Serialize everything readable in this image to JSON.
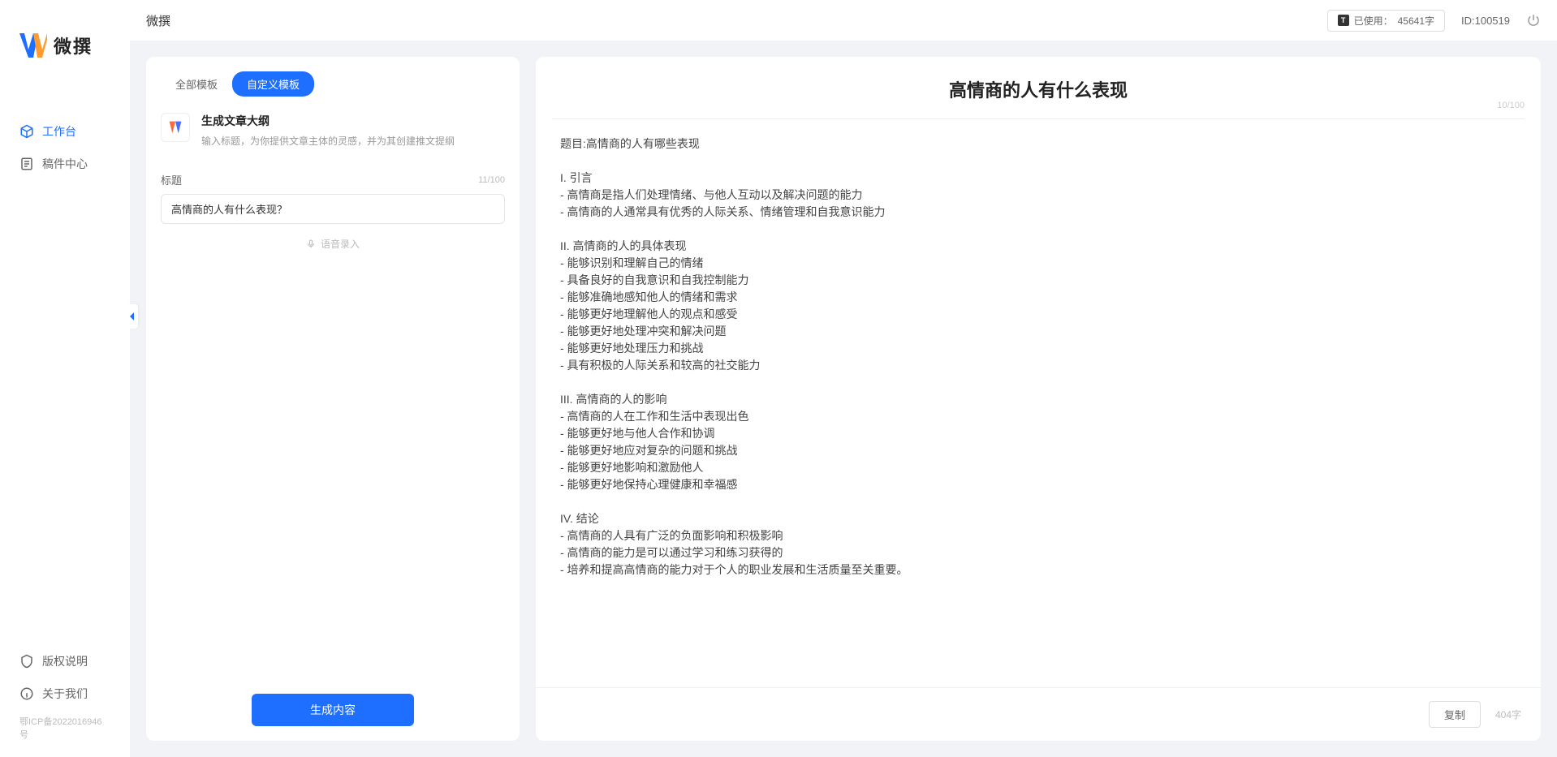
{
  "brand": "微撰",
  "sidebar": {
    "nav": [
      {
        "label": "工作台",
        "icon": "cube"
      },
      {
        "label": "稿件中心",
        "icon": "doc"
      }
    ],
    "bottom": [
      {
        "label": "版权说明",
        "icon": "shield"
      },
      {
        "label": "关于我们",
        "icon": "info"
      }
    ],
    "icp": "鄂ICP备2022016946号"
  },
  "topbar": {
    "title": "微撰",
    "usage_label": "已使用：",
    "usage_value": "45641字",
    "id_label": "ID:100519"
  },
  "tabs": {
    "all": "全部模板",
    "custom": "自定义模板"
  },
  "template": {
    "title": "生成文章大纲",
    "desc": "输入标题，为你提供文章主体的灵感，并为其创建推文提纲"
  },
  "form": {
    "title_label": "标题",
    "title_count": "11/100",
    "title_value": "高情商的人有什么表现？",
    "voice_hint": "语音录入"
  },
  "generate_label": "生成内容",
  "output": {
    "title": "高情商的人有什么表现",
    "title_count": "10/100",
    "body": "题目:高情商的人有哪些表现\n\nI. 引言\n- 高情商是指人们处理情绪、与他人互动以及解决问题的能力\n- 高情商的人通常具有优秀的人际关系、情绪管理和自我意识能力\n\nII. 高情商的人的具体表现\n- 能够识别和理解自己的情绪\n- 具备良好的自我意识和自我控制能力\n- 能够准确地感知他人的情绪和需求\n- 能够更好地理解他人的观点和感受\n- 能够更好地处理冲突和解决问题\n- 能够更好地处理压力和挑战\n- 具有积极的人际关系和较高的社交能力\n\nIII. 高情商的人的影响\n- 高情商的人在工作和生活中表现出色\n- 能够更好地与他人合作和协调\n- 能够更好地应对复杂的问题和挑战\n- 能够更好地影响和激励他人\n- 能够更好地保持心理健康和幸福感\n\nIV. 结论\n- 高情商的人具有广泛的负面影响和积极影响\n- 高情商的能力是可以通过学习和练习获得的\n- 培养和提高高情商的能力对于个人的职业发展和生活质量至关重要。",
    "copy_label": "复制",
    "word_count": "404字"
  }
}
